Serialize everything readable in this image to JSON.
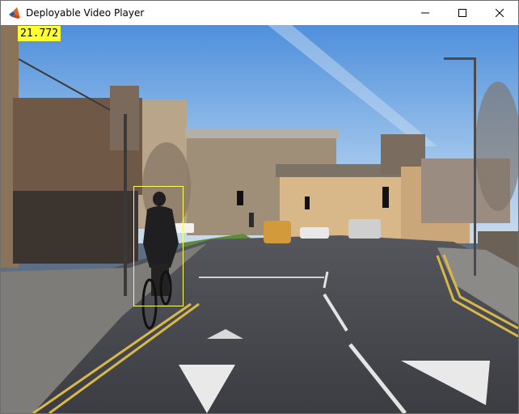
{
  "window": {
    "title": "Deployable Video Player",
    "controls": {
      "minimize": "minimize-icon",
      "maximize": "maximize-icon",
      "close": "close-icon"
    }
  },
  "video": {
    "timestamp": "21.772",
    "overlay_color": "#ffff33",
    "detection_box_color": "#ffff55"
  }
}
